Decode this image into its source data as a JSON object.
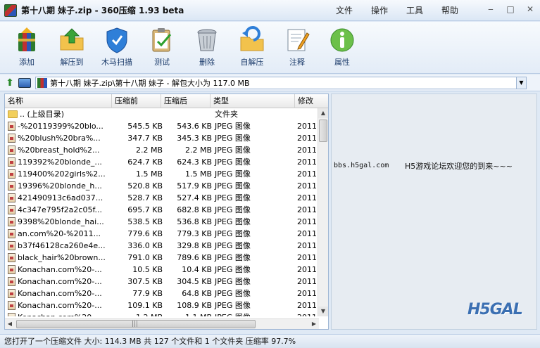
{
  "window": {
    "title": "第十八期 妹子.zip - 360压缩 1.93 beta",
    "menus": [
      "文件",
      "操作",
      "工具",
      "帮助"
    ],
    "controls": [
      "‒",
      "□",
      "✕"
    ]
  },
  "toolbar": {
    "buttons": [
      {
        "label": "添加",
        "icon": "add-archive-icon"
      },
      {
        "label": "解压到",
        "icon": "extract-to-icon"
      },
      {
        "label": "木马扫描",
        "icon": "shield-scan-icon"
      },
      {
        "label": "测试",
        "icon": "test-clipboard-icon"
      },
      {
        "label": "删除",
        "icon": "trash-icon"
      },
      {
        "label": "自解压",
        "icon": "self-extract-icon"
      },
      {
        "label": "注释",
        "icon": "comment-icon"
      },
      {
        "label": "属性",
        "icon": "info-icon"
      }
    ]
  },
  "address": {
    "path": "第十八期 妹子.zip\\第十八期 妹子 - 解包大小为 117.0 MB"
  },
  "list": {
    "columns": [
      "名称",
      "压缩前",
      "压缩后",
      "类型",
      "修改"
    ],
    "parent_row": {
      "name": ".. (上级目录)",
      "type": "文件夹"
    },
    "rows": [
      {
        "name": "-%20119399%20blo...",
        "before": "545.5 KB",
        "after": "543.6 KB",
        "type": "JPEG 图像",
        "modified": "2011"
      },
      {
        "name": "%20blush%20bra%...",
        "before": "347.7 KB",
        "after": "345.3 KB",
        "type": "JPEG 图像",
        "modified": "2011"
      },
      {
        "name": "%20breast_hold%2...",
        "before": "2.2 MB",
        "after": "2.2 MB",
        "type": "JPEG 图像",
        "modified": "2011"
      },
      {
        "name": "119392%20blonde_...",
        "before": "624.7 KB",
        "after": "624.3 KB",
        "type": "JPEG 图像",
        "modified": "2011"
      },
      {
        "name": "119400%202girls%2...",
        "before": "1.5 MB",
        "after": "1.5 MB",
        "type": "JPEG 图像",
        "modified": "2011"
      },
      {
        "name": "19396%20blonde_h...",
        "before": "520.8 KB",
        "after": "517.9 KB",
        "type": "JPEG 图像",
        "modified": "2011"
      },
      {
        "name": "421490913c6ad037...",
        "before": "528.7 KB",
        "after": "527.4 KB",
        "type": "JPEG 图像",
        "modified": "2011"
      },
      {
        "name": "4c347e795f2a2c05f...",
        "before": "695.7 KB",
        "after": "682.8 KB",
        "type": "JPEG 图像",
        "modified": "2011"
      },
      {
        "name": "9398%20blonde_hai...",
        "before": "538.5 KB",
        "after": "536.8 KB",
        "type": "JPEG 图像",
        "modified": "2011"
      },
      {
        "name": "an.com%20-%2011...",
        "before": "779.6 KB",
        "after": "779.3 KB",
        "type": "JPEG 图像",
        "modified": "2011"
      },
      {
        "name": "b37f46128ca260e4e...",
        "before": "336.0 KB",
        "after": "329.8 KB",
        "type": "JPEG 图像",
        "modified": "2011"
      },
      {
        "name": "black_hair%20brown...",
        "before": "791.0 KB",
        "after": "789.6 KB",
        "type": "JPEG 图像",
        "modified": "2011"
      },
      {
        "name": "Konachan.com%20-...",
        "before": "10.5 KB",
        "after": "10.4 KB",
        "type": "JPEG 图像",
        "modified": "2011"
      },
      {
        "name": "Konachan.com%20-...",
        "before": "307.5 KB",
        "after": "304.5 KB",
        "type": "JPEG 图像",
        "modified": "2011"
      },
      {
        "name": "Konachan.com%20-...",
        "before": "77.9 KB",
        "after": "64.8 KB",
        "type": "JPEG 图像",
        "modified": "2011"
      },
      {
        "name": "Konachan.com%20-...",
        "before": "109.1 KB",
        "after": "108.9 KB",
        "type": "JPEG 图像",
        "modified": "2011"
      },
      {
        "name": "Konachan.com%20-...",
        "before": "1.2 MB",
        "after": "1.1 MB",
        "type": "JPEG 图像",
        "modified": "2011"
      }
    ]
  },
  "comment": {
    "site": "bbs.h5gal.com",
    "message": "H5游戏论坛欢迎您的到来~~~",
    "logo_text": "H5GAL"
  },
  "status": {
    "text": "您打开了一个压缩文件 大小: 114.3 MB 共 127 个文件和 1 个文件夹 压缩率 97.7%"
  },
  "colors": {
    "accent": "#3b6fb2",
    "toolbar_bg": "#e3ecf7",
    "comment_bg": "#e7ecf2"
  }
}
